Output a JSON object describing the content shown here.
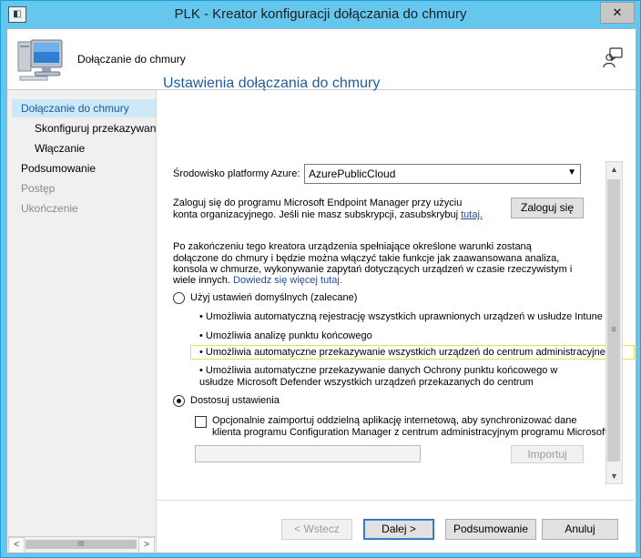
{
  "window": {
    "title": "PLK - Kreator konfiguracji dołączania do chmury",
    "app_icon": "window-icon",
    "close_label": "✕"
  },
  "header": {
    "title": "Dołączanie do chmury"
  },
  "nav": {
    "items": [
      {
        "label": "Dołączanie do chmury",
        "state": "active"
      },
      {
        "label": "Skonfiguruj przekazywan",
        "state": "normal"
      },
      {
        "label": "Włączanie",
        "state": "normal"
      },
      {
        "label": "Podsumowanie",
        "state": "normal"
      },
      {
        "label": "Postęp",
        "state": "disabled"
      },
      {
        "label": "Ukończenie",
        "state": "disabled"
      }
    ]
  },
  "page": {
    "title": "Ustawienia dołączania do chmury",
    "azure_env_label": "Środowisko platformy Azure:",
    "azure_env_value": "AzurePublicCloud",
    "signin_text_1": "Zaloguj się do programu Microsoft Endpoint Manager przy użyciu",
    "signin_text_2": "konta organizacyjnego. Jeśli nie masz subskrypcji, zasubskrybuj",
    "signin_link": "tutaj.",
    "signin_button": "Zaloguj się",
    "desc_1": "Po zakończeniu tego kreatora urządzenia spełniające określone warunki zostaną",
    "desc_2": "dołączone do chmury i będzie można włączyć takie funkcje jak zaawansowana analiza,",
    "desc_3": "konsola w chmurze, wykonywanie zapytań dotyczących urządzeń w czasie rzeczywistym i",
    "desc_4": "wiele innych.",
    "desc_link": "Dowiedz się więcej tutaj.",
    "radio_default_label": "Użyj ustawień domyślnych (zalecane)",
    "bullets": [
      "• Umożliwia automatyczną rejestrację wszystkich uprawnionych urządzeń w usłudze Intune",
      "• Umożliwia analizę punktu końcowego",
      "• Umożliwia automatyczne przekazywanie wszystkich urządzeń do centrum administracyjnego",
      "• Umożliwia automatyczne przekazywanie danych Ochrony punktu końcowego w",
      "usłudze Microsoft Defender wszystkich urządzeń przekazanych do centrum"
    ],
    "radio_custom_label": "Dostosuj ustawienia",
    "checkbox_text_1": "Opcjonalnie zaimportuj oddzielną aplikację internetową, aby synchronizować dane",
    "checkbox_text_2": "klienta programu Configuration Manager z centrum administracyjnym programu Microsoft",
    "import_button": "Importuj"
  },
  "footer": {
    "back": "< Wstecz",
    "next": "Dalej >",
    "summary": "Podsumowanie",
    "cancel": "Anuluj"
  },
  "scrollbar": {
    "up": "▲",
    "down": "▼",
    "grip": "≡",
    "left": "<",
    "right": ">",
    "thumb_grip": "III"
  }
}
